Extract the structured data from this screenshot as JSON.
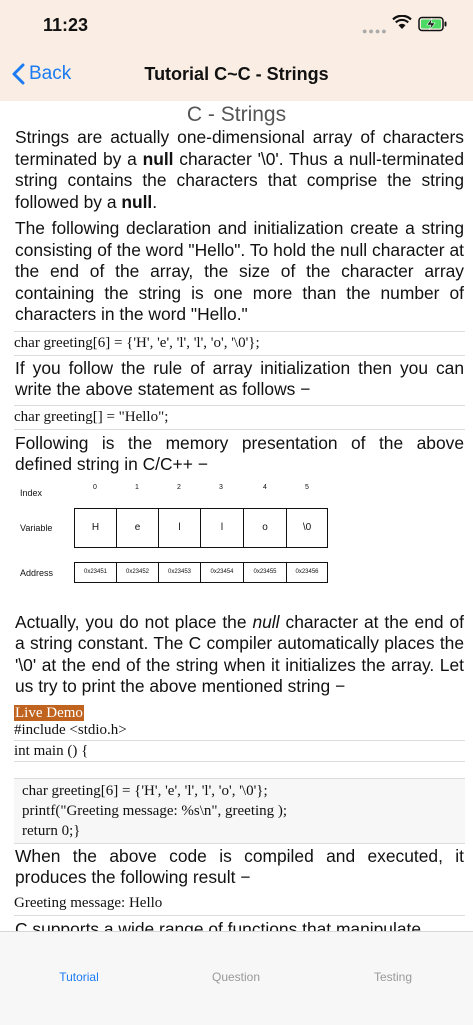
{
  "status": {
    "time": "11:23"
  },
  "nav": {
    "back_label": "Back",
    "title": "Tutorial C~C - Strings"
  },
  "content": {
    "heading": "C - Strings",
    "p1_a": "Strings are actually one-dimensional array of characters terminated by a ",
    "p1_b": "null",
    "p1_c": " character '\\0'. Thus a null-terminated string contains the characters that comprise the string followed by a ",
    "p1_d": "null",
    "p1_e": ".",
    "p2": "The following declaration and initialization create a string consisting of the word \"Hello\". To hold the null character at the end of the array, the size of the character array containing the string is one more than the number of characters in the word \"Hello.\"",
    "code1": "char greeting[6] = {'H', 'e', 'l', 'l', 'o', '\\0'};",
    "p3": "If you follow the rule of array initialization then you can write the above statement as follows −",
    "code2": "char greeting[] = \"Hello\";",
    "p4": "Following is the memory presentation of the above defined string in C/C++ −",
    "memory": {
      "index_label": "Index",
      "variable_label": "Variable",
      "address_label": "Address",
      "indexes": [
        "0",
        "1",
        "2",
        "3",
        "4",
        "5"
      ],
      "values": [
        "H",
        "e",
        "l",
        "l",
        "o",
        "\\0"
      ],
      "addresses": [
        "0x23451",
        "0x23452",
        "0x23453",
        "0x23454",
        "0x23455",
        "0x23456"
      ]
    },
    "p5_a": "Actually, you do not place the ",
    "p5_b": "null",
    "p5_c": " character at the end of a string constant. The C compiler automatically places the '\\0' at the end of the string when it initializes the array. Let us try to print the above mentioned string −",
    "live_demo": "Live Demo",
    "code3_line1": "#include <stdio.h>",
    "code3_line2": "int main () {",
    "code3_line3": "char greeting[6] = {'H', 'e', 'l', 'l', 'o', '\\0'};",
    "code3_line4": "printf(\"Greeting message: %s\\n\", greeting );",
    "code3_line5": "return 0;}",
    "p6": "When the above code is compiled and executed, it produces the following result −",
    "code4": "Greeting message: Hello",
    "p7": "C supports a wide range of functions that manipulate"
  },
  "tabs": [
    {
      "label": "Tutorial"
    },
    {
      "label": "Question"
    },
    {
      "label": "Testing"
    }
  ],
  "colors": {
    "accent": "#1a7bf2",
    "header_bg": "#faeee4",
    "live_demo_bg": "#c0631e"
  }
}
